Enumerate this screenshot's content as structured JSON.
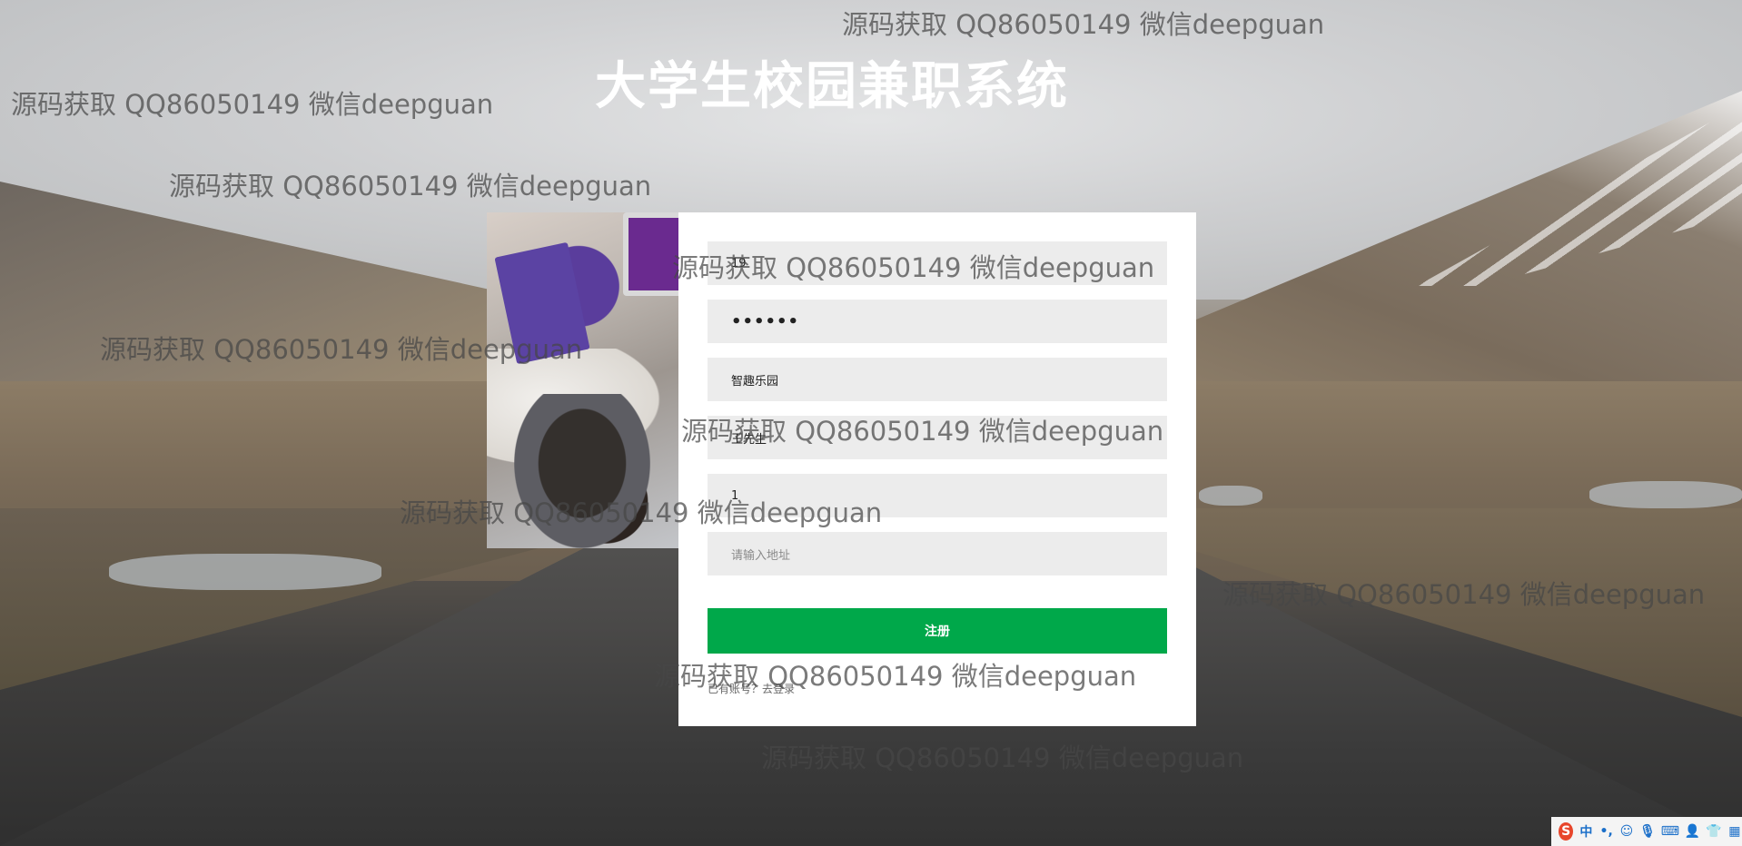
{
  "page": {
    "title": "大学生校园兼职系统"
  },
  "form": {
    "fields": [
      {
        "value": "19",
        "placeholder": "",
        "type": "text"
      },
      {
        "value": "••••••",
        "placeholder": "",
        "type": "password"
      },
      {
        "value": "智趣乐园",
        "placeholder": "",
        "type": "text"
      },
      {
        "value": "王先生",
        "placeholder": "",
        "type": "text"
      },
      {
        "value": "1",
        "placeholder": "",
        "type": "text"
      },
      {
        "value": "",
        "placeholder": "请输入地址",
        "type": "text"
      }
    ],
    "submit_label": "注册",
    "login_link": "已有账号？去登录"
  },
  "watermarks": [
    "源码获取 QQ86050149 微信deepguan",
    "源码获取 QQ86050149 微信deepguan",
    "源码获取 QQ86050149 微信deepguan",
    "源码获取 QQ86050149 微信deepguan",
    "源码获取 QQ86050149 微信deepguan",
    "源码获取 QQ86050149 微信deepguan",
    "源码获取 QQ86050149 微信deepguan",
    "源码获取 QQ86050149 微信deepguan",
    "源码获取 QQ86050149 微信deepguan",
    "源码获取 QQ86050149 微信deepguan"
  ],
  "taskbar": {
    "ime_logo": "S",
    "ime_mode": "中",
    "punct": "•,",
    "icons": [
      "emoji-icon",
      "microphone-icon",
      "keyboard-icon",
      "user-icon",
      "shirt-icon",
      "grid-icon"
    ]
  },
  "colors": {
    "accent": "#00a84a",
    "field_bg": "#ececec",
    "title": "#ffffff"
  }
}
